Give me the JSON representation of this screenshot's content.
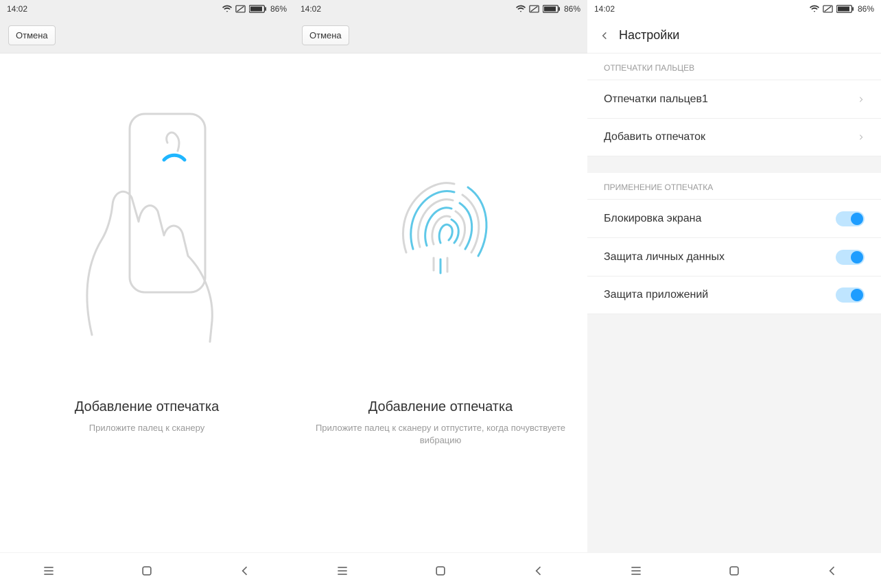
{
  "status": {
    "time": "14:02",
    "battery": "86%"
  },
  "screen1": {
    "cancel": "Отмена",
    "title": "Добавление отпечатка",
    "subtitle": "Приложите палец к сканеру"
  },
  "screen2": {
    "cancel": "Отмена",
    "title": "Добавление отпечатка",
    "subtitle": "Приложите палец к сканеру и отпустите, когда почувствуете вибрацию"
  },
  "screen3": {
    "header": "Настройки",
    "section1_label": "ОТПЕЧАТКИ ПАЛЬЦЕВ",
    "row_fingerprint1": "Отпечатки пальцев1",
    "row_add": "Добавить отпечаток",
    "section2_label": "ПРИМЕНЕНИЕ ОТПЕЧАТКА",
    "row_lockscreen": "Блокировка экрана",
    "row_privacy": "Защита личных данных",
    "row_apps": "Защита приложений"
  }
}
